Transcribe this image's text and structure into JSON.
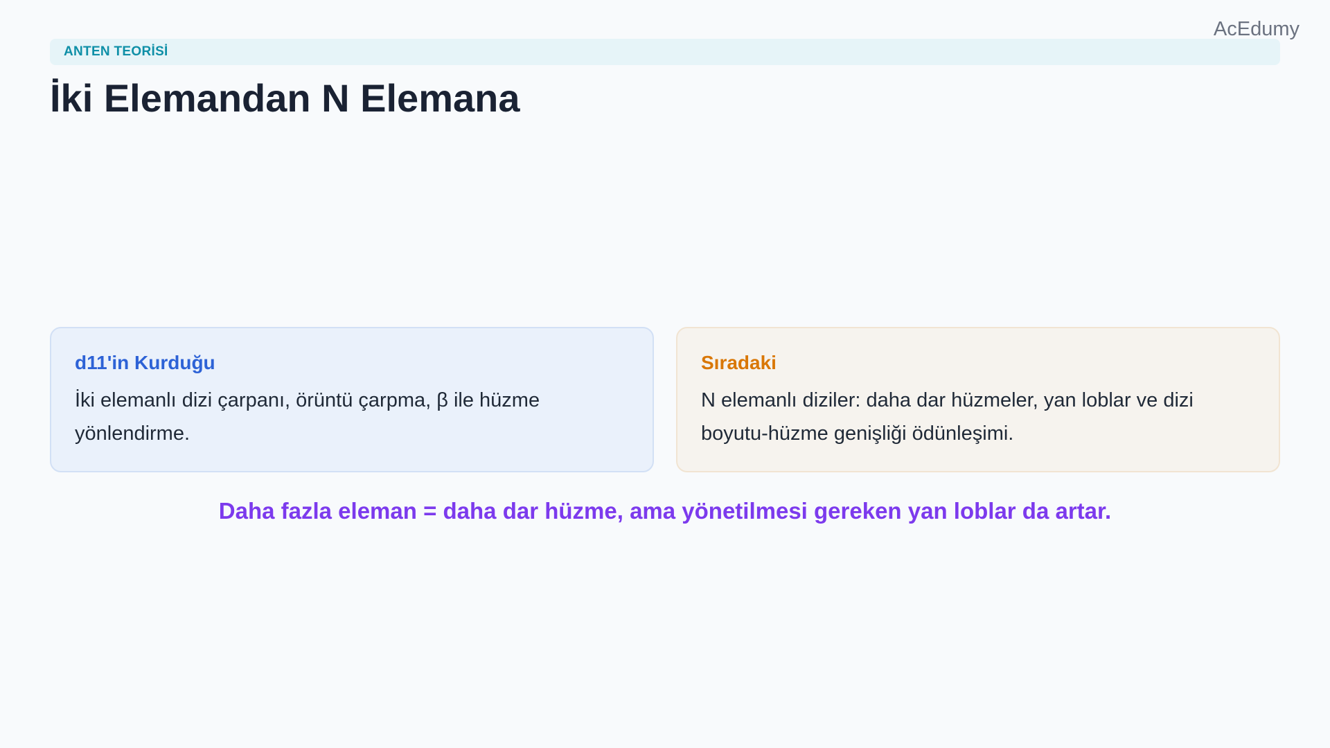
{
  "brand": "AcEdumy",
  "section_tag": "ANTEN TEORİSİ",
  "title": "İki Elemandan N Elemana",
  "cards": [
    {
      "title": "d11'in Kurduğu",
      "body": "İki elemanlı dizi çarpanı, örüntü çarpma, β ile hüzme yönlendirme."
    },
    {
      "title": "Sıradaki",
      "body": "N elemanlı diziler: daha dar hüzmeler, yan loblar ve dizi boyutu-hüzme genişliği ödünleşimi."
    }
  ],
  "takeaway": "Daha fazla eleman = daha dar hüzme, ama yönetilmesi gereken yan loblar da artar.",
  "colors": {
    "background": "#f8fafc",
    "tag_text": "#0e8fa7",
    "left_card_accent": "#2d62d6",
    "right_card_accent": "#d97706",
    "takeaway": "#7c3aed"
  }
}
